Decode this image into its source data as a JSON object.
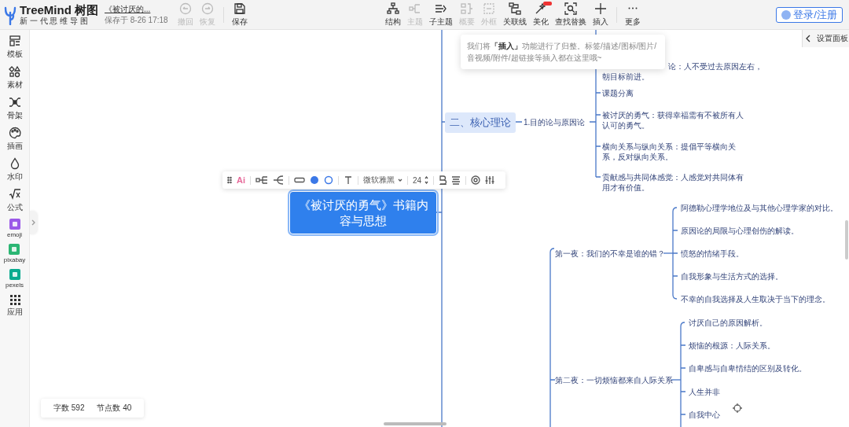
{
  "app": {
    "logo": "TreeMind",
    "logo_cn": "树图",
    "slogan": "新 一 代 思 维 导 图"
  },
  "document": {
    "title": "《被讨厌的...",
    "saved": "保存于 8-26 17:18"
  },
  "history": [
    {
      "label": "撤回",
      "disabled": true
    },
    {
      "label": "恢复",
      "disabled": true
    },
    {
      "label": "保存",
      "disabled": false
    }
  ],
  "toolbar": [
    {
      "label": "结构",
      "disabled": false,
      "badge": false
    },
    {
      "label": "主题",
      "disabled": true,
      "badge": false
    },
    {
      "label": "子主题",
      "disabled": false,
      "badge": false
    },
    {
      "label": "概要",
      "disabled": true,
      "badge": false
    },
    {
      "label": "外框",
      "disabled": true,
      "badge": false
    },
    {
      "label": "关联线",
      "disabled": false,
      "badge": false
    },
    {
      "label": "美化",
      "disabled": false,
      "badge": true
    },
    {
      "label": "查找替换",
      "disabled": false,
      "badge": false
    },
    {
      "label": "插入",
      "disabled": false,
      "badge": false
    },
    {
      "label": "更多",
      "disabled": false,
      "badge": false
    }
  ],
  "login": "登录/注册",
  "settings_panel": "设置面板",
  "sidebar": [
    {
      "label": "模板"
    },
    {
      "label": "素材"
    },
    {
      "label": "骨架"
    },
    {
      "label": "插画"
    },
    {
      "label": "水印"
    },
    {
      "label": "公式"
    },
    {
      "label": "emoji"
    },
    {
      "label": "pixabay"
    },
    {
      "label": "pexels"
    },
    {
      "label": "应用"
    }
  ],
  "tooltip": "我们将**「插入」**功能进行了归整。标签/描述/图标/图片/音视频/附件/超链接等插入都在这里哦~",
  "node_toolbar": {
    "ai": "Ai",
    "font": "微软雅黑",
    "size": "24"
  },
  "mindmap": {
    "root": {
      "text": "《被讨厌的勇气》书籍内容与思想",
      "selected": true
    },
    "branch": {
      "topic": "二、核心理论",
      "sub": "1.目的论与原因论",
      "items": [
        "论：人不受过去原因左右，朝目标前进。",
        "课题分离",
        "被讨厌的勇气：获得幸福需有不被所有人认可的勇气。",
        "横向关系与纵向关系：提倡平等横向关系，反对纵向关系。",
        "贡献感与共同体感觉：人感觉对共同体有用才有价值。"
      ]
    },
    "nights": [
      {
        "topic": "第一夜：我们的不幸是谁的错？",
        "items": [
          "阿德勒心理学地位及与其他心理学家的对比。",
          "原因论的局限与心理创伤的解读。",
          "愤怒的情绪手段。",
          "自我形象与生活方式的选择。",
          "不幸的自我选择及人生取决于当下的理念。"
        ]
      },
      {
        "topic": "第二夜：一切烦恼都来自人际关系",
        "items": [
          "讨厌自己的原因解析。",
          "烦恼的根源：人际关系。",
          "自卑感与自卑情结的区别及转化。",
          "人生并非",
          "自我中心"
        ]
      }
    ]
  },
  "status": {
    "words": "字数 592",
    "nodes": "节点数 40"
  }
}
